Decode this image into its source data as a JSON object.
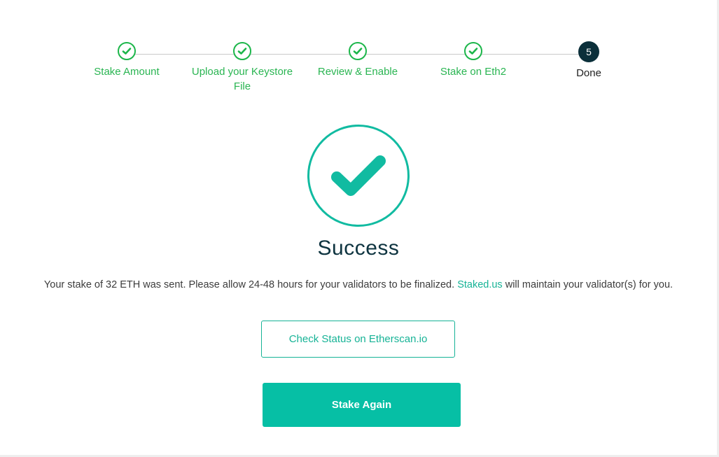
{
  "stepper": {
    "steps": [
      {
        "label": "Stake Amount",
        "status": "complete",
        "icon": "check-icon"
      },
      {
        "label": "Upload your Keystore File",
        "status": "complete",
        "icon": "check-icon"
      },
      {
        "label": "Review & Enable",
        "status": "complete",
        "icon": "check-icon"
      },
      {
        "label": "Stake on Eth2",
        "status": "complete",
        "icon": "check-icon"
      },
      {
        "label": "Done",
        "status": "current",
        "number": "5"
      }
    ]
  },
  "result": {
    "icon": "success-check-icon",
    "title": "Success",
    "message_before": "Your stake of 32 ETH was sent. Please allow 24-48 hours for your validators to be finalized.",
    "link_text": "Staked.us",
    "message_after": "will maintain your validator(s) for you."
  },
  "actions": {
    "check_status_label": "Check Status on Etherscan.io",
    "stake_again_label": "Stake Again"
  },
  "colors": {
    "step_complete": "#1cb64a",
    "current_step": "#0b2f3a",
    "accent": "#06bfa5",
    "title": "#0e3440"
  }
}
